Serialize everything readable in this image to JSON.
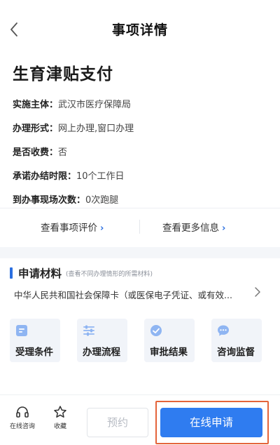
{
  "header": {
    "title": "事项详情",
    "back_icon": "chevron-left-icon"
  },
  "item": {
    "title": "生育津贴支付",
    "info": [
      {
        "key": "实施主体：",
        "value": "武汉市医疗保障局"
      },
      {
        "key": "办理形式：",
        "value": "网上办理,窗口办理"
      },
      {
        "key": "是否收费：",
        "value": "否"
      },
      {
        "key": "承诺办结时限：",
        "value": "10个工作日"
      },
      {
        "key": "到办事现场次数：",
        "value": "0次跑腿"
      }
    ]
  },
  "links": {
    "evaluate": "查看事项评价",
    "more_info": "查看更多信息",
    "chevron": "›"
  },
  "materials": {
    "title": "申请材料",
    "subtitle": "(查看不同办理情形的所需材料)",
    "description": "中华人民共和国社会保障卡（或医保电子凭证、或有效...",
    "arrow_icon": "chevron-right-icon"
  },
  "tiles": [
    {
      "label": "受理条件",
      "icon": "document-icon"
    },
    {
      "label": "办理流程",
      "icon": "sliders-icon"
    },
    {
      "label": "审批结果",
      "icon": "check-circle-icon"
    },
    {
      "label": "咨询监督",
      "icon": "chat-bubble-icon"
    }
  ],
  "bottom_bar": {
    "consult_label": "在线咨询",
    "favorite_label": "收藏",
    "reserve_label": "预约",
    "apply_label": "在线申请"
  },
  "colors": {
    "accent": "#2f7cf0",
    "tile_bg": "#f1f4f9",
    "tile_icon": "#8fb5f2",
    "highlight_frame": "#e4643a"
  }
}
